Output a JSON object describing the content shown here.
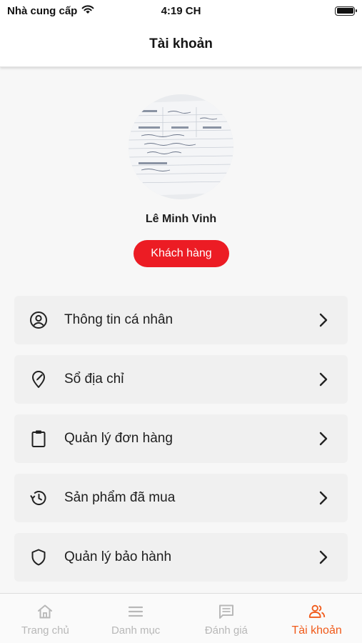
{
  "status_bar": {
    "carrier": "Nhà cung cấp",
    "time": "4:19 CH",
    "wifi_icon": "wifi-icon",
    "battery_icon": "battery-icon"
  },
  "header": {
    "title": "Tài khoản"
  },
  "profile": {
    "name": "Lê Minh Vinh",
    "role": "Khách hàng",
    "role_color": "#ec1c24"
  },
  "menu": [
    {
      "label": "Thông tin cá nhân",
      "icon": "user-circle-icon"
    },
    {
      "label": "Sổ địa chỉ",
      "icon": "location-pin-icon"
    },
    {
      "label": "Quản lý đơn hàng",
      "icon": "clipboard-icon"
    },
    {
      "label": "Sản phẩm đã mua",
      "icon": "history-icon"
    },
    {
      "label": "Quản lý bảo hành",
      "icon": "shield-icon"
    }
  ],
  "tabs": [
    {
      "label": "Trang chủ",
      "icon": "home-icon",
      "active": false
    },
    {
      "label": "Danh mục",
      "icon": "menu-icon",
      "active": false
    },
    {
      "label": "Đánh giá",
      "icon": "chat-icon",
      "active": false
    },
    {
      "label": "Tài khoản",
      "icon": "users-icon",
      "active": true
    }
  ],
  "colors": {
    "accent": "#f05a1a",
    "badge": "#ec1c24",
    "inactive_tab": "#b8b8b8"
  }
}
